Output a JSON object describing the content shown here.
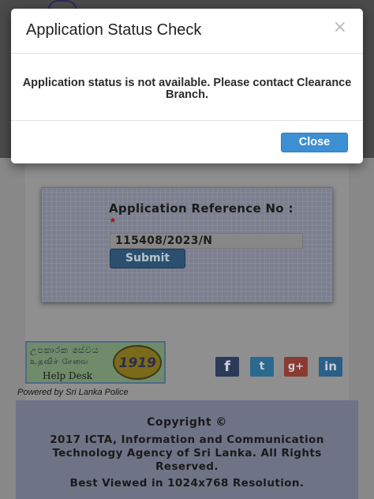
{
  "modal": {
    "title": "Application Status Check",
    "close_icon": "×",
    "message": "Application status is not available. Please contact Clearance Branch.",
    "close_button": "Close"
  },
  "form": {
    "label": "Application Reference No :",
    "required_marker": "*",
    "reference_value": "115408/2023/N",
    "submit_button": "Submit"
  },
  "helpdesk": {
    "line1": "උපකාරක සේවය",
    "line2": "உதவிச் சேவை",
    "line3": "Help Desk",
    "number": "1919"
  },
  "powered_by": "Powered by Sri Lanka Police",
  "social": {
    "facebook": "f",
    "twitter": "t",
    "googleplus": "g+",
    "linkedin": "in"
  },
  "footer": {
    "copyright": "Copyright ©",
    "organization": "2017 ICTA, Information and Communication Technology Agency of Sri Lanka. All Rights Reserved.",
    "best_viewed": "Best Viewed in 1024x768 Resolution."
  },
  "colors": {
    "close_button_bg": "#3c8fd3",
    "submit_button_bg": "#2b4f6e",
    "backdrop": "#888888"
  }
}
